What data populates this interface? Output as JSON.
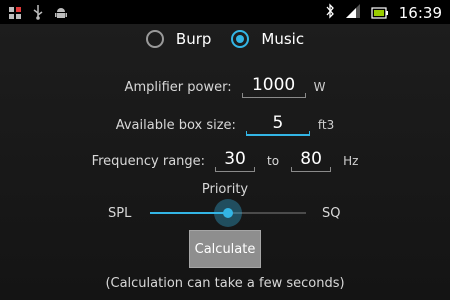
{
  "status_bar": {
    "left_icons": [
      "multi-task-icon",
      "usb-icon",
      "android-debug-icon"
    ],
    "right_icons": [
      "bluetooth-icon",
      "signal-icon",
      "battery-icon"
    ],
    "time": "16:39"
  },
  "mode": {
    "options": [
      {
        "label": "Burp",
        "selected": false
      },
      {
        "label": "Music",
        "selected": true
      }
    ]
  },
  "amplifier": {
    "label": "Amplifier power:",
    "value": "1000",
    "unit": "W"
  },
  "box_size": {
    "label": "Available box size:",
    "value": "5",
    "unit": "ft3"
  },
  "frequency": {
    "label": "Frequency range:",
    "from": "30",
    "to_label": "to",
    "to": "80",
    "unit": "Hz"
  },
  "priority": {
    "title": "Priority",
    "left_label": "SPL",
    "right_label": "SQ",
    "value": 0.5
  },
  "calculate_label": "Calculate",
  "note": "(Calculation can take a few seconds)",
  "colors": {
    "accent": "#33b5e5"
  }
}
